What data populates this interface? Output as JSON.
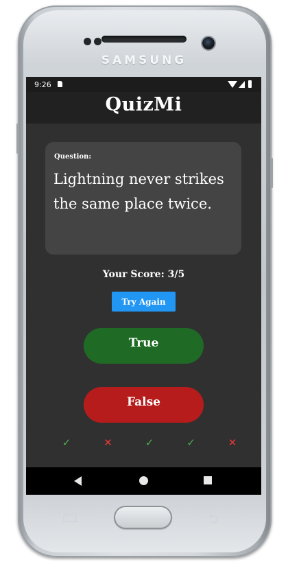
{
  "device": {
    "brand": "SAMSUNG"
  },
  "status_bar": {
    "time": "9:26",
    "icons": [
      "sd-card-icon",
      "wifi-icon",
      "signal-icon",
      "battery-icon"
    ]
  },
  "app": {
    "title": "QuizMi"
  },
  "question": {
    "label": "Question:",
    "text": "Lightning never strikes the same place twice."
  },
  "score": {
    "text": "Your Score: 3/5"
  },
  "buttons": {
    "try_again": "Try Again",
    "true_label": "True",
    "false_label": "False"
  },
  "score_tracker": [
    {
      "glyph": "✓",
      "result": "correct"
    },
    {
      "glyph": "✕",
      "result": "wrong"
    },
    {
      "glyph": "✓",
      "result": "correct"
    },
    {
      "glyph": "✓",
      "result": "correct"
    },
    {
      "glyph": "✕",
      "result": "wrong"
    }
  ],
  "colors": {
    "app_background": "#303030",
    "app_bar": "#212121",
    "question_card": "#444444",
    "try_again": "#2196f3",
    "true_button": "#1f6b26",
    "false_button": "#b71c1c",
    "check": "#4caf50",
    "cross": "#e53935"
  },
  "nav_bar": {
    "icons": [
      "back-icon",
      "home-icon",
      "recents-icon"
    ]
  }
}
